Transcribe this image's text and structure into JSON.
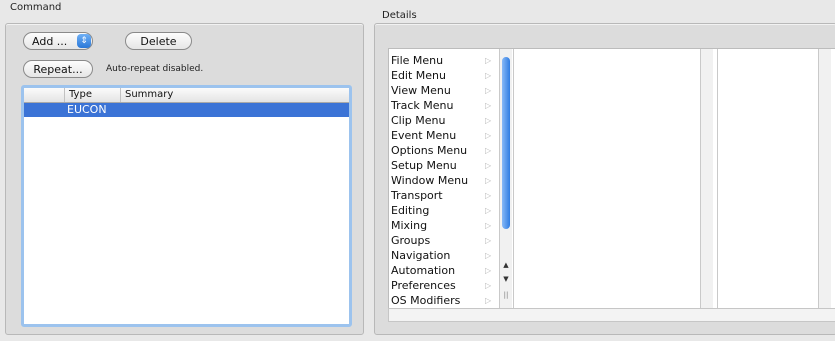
{
  "command": {
    "group_label": "Command",
    "add_label": "Add ...",
    "delete_label": "Delete",
    "repeat_label": "Repeat...",
    "repeat_status": "Auto-repeat disabled.",
    "table": {
      "columns": [
        "Type",
        "Summary"
      ],
      "rows": [
        {
          "type": "EUCON",
          "summary": ""
        }
      ]
    }
  },
  "details": {
    "group_label": "Details",
    "menus": [
      "File Menu",
      "Edit Menu",
      "View Menu",
      "Track Menu",
      "Clip Menu",
      "Event Menu",
      "Options Menu",
      "Setup Menu",
      "Window Menu",
      "Transport",
      "Editing",
      "Mixing",
      "Groups",
      "Navigation",
      "Automation",
      "Preferences",
      "OS Modifiers"
    ]
  },
  "icons": {
    "popup": "updown-arrows-icon",
    "submenu": "submenu-triangle-icon",
    "scroll_up": "scroll-up-icon",
    "scroll_down": "scroll-down-icon"
  },
  "colors": {
    "selection": "#3b73d6",
    "focus_ring": "#9cc3ee",
    "scroll_thumb": "#2f7ce2"
  }
}
